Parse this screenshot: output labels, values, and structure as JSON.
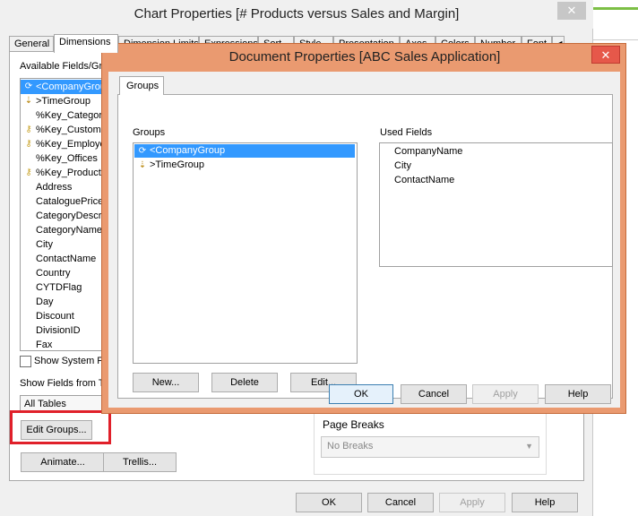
{
  "chart_window": {
    "title": "Chart Properties [# Products versus Sales and Margin]",
    "close_glyph": "✕",
    "tabs": [
      "General",
      "Dimensions",
      "Dimension Limits",
      "Expressions",
      "Sort",
      "Style",
      "Presentation",
      "Axes",
      "Colors",
      "Number",
      "Font"
    ],
    "tab_more": "◀",
    "available_fields_label": "Available Fields/Groups",
    "fields": [
      {
        "icon": "cycle-group-icon",
        "label": "<CompanyGroup"
      },
      {
        "icon": "drill-group-icon",
        "label": ">TimeGroup"
      },
      {
        "icon": "",
        "label": "%Key_Categories"
      },
      {
        "icon": "key-icon",
        "label": "%Key_Customers"
      },
      {
        "icon": "key-icon",
        "label": "%Key_Employees"
      },
      {
        "icon": "",
        "label": "%Key_Offices"
      },
      {
        "icon": "key-icon",
        "label": "%Key_Products"
      },
      {
        "icon": "",
        "label": "Address"
      },
      {
        "icon": "",
        "label": "CataloguePrice"
      },
      {
        "icon": "",
        "label": "CategoryDescription"
      },
      {
        "icon": "",
        "label": "CategoryName"
      },
      {
        "icon": "",
        "label": "City"
      },
      {
        "icon": "",
        "label": "ContactName"
      },
      {
        "icon": "",
        "label": "Country"
      },
      {
        "icon": "",
        "label": "CYTDFlag"
      },
      {
        "icon": "",
        "label": "Day"
      },
      {
        "icon": "",
        "label": "Discount"
      },
      {
        "icon": "",
        "label": "DivisionID"
      },
      {
        "icon": "",
        "label": "Fax"
      }
    ],
    "show_system_fields_label": "Show System Fields",
    "show_fields_from_label": "Show Fields from Table",
    "tables_select_value": "All Tables",
    "edit_groups_label": "Edit Groups...",
    "animate_label": "Animate...",
    "trellis_label": "Trellis...",
    "page_breaks_label": "Page Breaks",
    "page_breaks_value": "No Breaks",
    "ok_label": "OK",
    "cancel_label": "Cancel",
    "apply_label": "Apply",
    "help_label": "Help"
  },
  "doc_dialog": {
    "title": "Document Properties [ABC Sales Application]",
    "close_glyph": "✕",
    "tab": "Groups",
    "groups_label": "Groups",
    "groups": [
      {
        "icon": "cycle-group-icon",
        "label": "<CompanyGroup"
      },
      {
        "icon": "drill-group-icon",
        "label": ">TimeGroup"
      }
    ],
    "used_fields_label": "Used Fields",
    "used_fields": [
      "CompanyName",
      "City",
      "ContactName"
    ],
    "new_label": "New...",
    "delete_label": "Delete",
    "edit_label": "Edit...",
    "ok_label": "OK",
    "cancel_label": "Cancel",
    "apply_label": "Apply",
    "help_label": "Help"
  },
  "colors": {
    "selection": "#3399ff",
    "dialog_frame": "#ea9a70",
    "close_red": "#e6584a",
    "highlight_red": "#e0202a"
  }
}
